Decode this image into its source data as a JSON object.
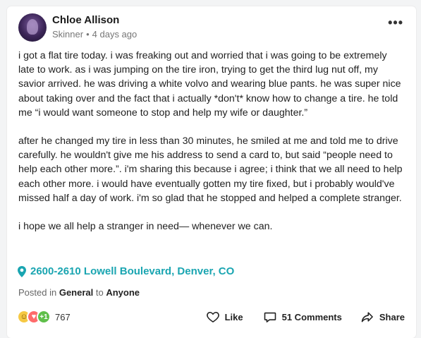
{
  "post": {
    "author": "Chloe Allison",
    "neighborhood": "Skinner",
    "time_ago": "4 days ago",
    "more_label": "•••",
    "paragraphs": [
      "i got a flat tire today. i was freaking out and worried that i was going to be extremely late to work. as i was jumping on the tire iron, trying to get the third lug nut off, my savior arrived. he was driving a white volvo and wearing blue pants. he was super nice about taking over and the fact that i actually *don't* know how to change a tire. he told me “i would want someone to stop and help my wife or daughter.”",
      "after he changed my tire in less than 30 minutes, he smiled at me and told me to drive carefully. he wouldn't give me his address to send a card to, but said “people need to help each other more.”. i'm sharing this because i agree; i think that we all need to help each other more. i would have eventually gotten my tire fixed, but i probably would've missed half a day of work. i'm so glad that he stopped and helped a complete stranger.",
      "i hope we all help a stranger in need— whenever we can."
    ],
    "location": "2600-2610 Lowell Boulevard, Denver, CO",
    "posted_prefix": "Posted in",
    "category": "General",
    "posted_mid": "to",
    "audience": "Anyone"
  },
  "footer": {
    "reaction_icons": [
      "smile-emoji",
      "heart-emoji",
      "plus-one-badge"
    ],
    "plus_one_text": "+1",
    "reaction_count": "767",
    "like_label": "Like",
    "comments_label": "51 Comments",
    "share_label": "Share"
  },
  "colors": {
    "accent": "#1aa5b1",
    "background": "#f3f4f5"
  }
}
